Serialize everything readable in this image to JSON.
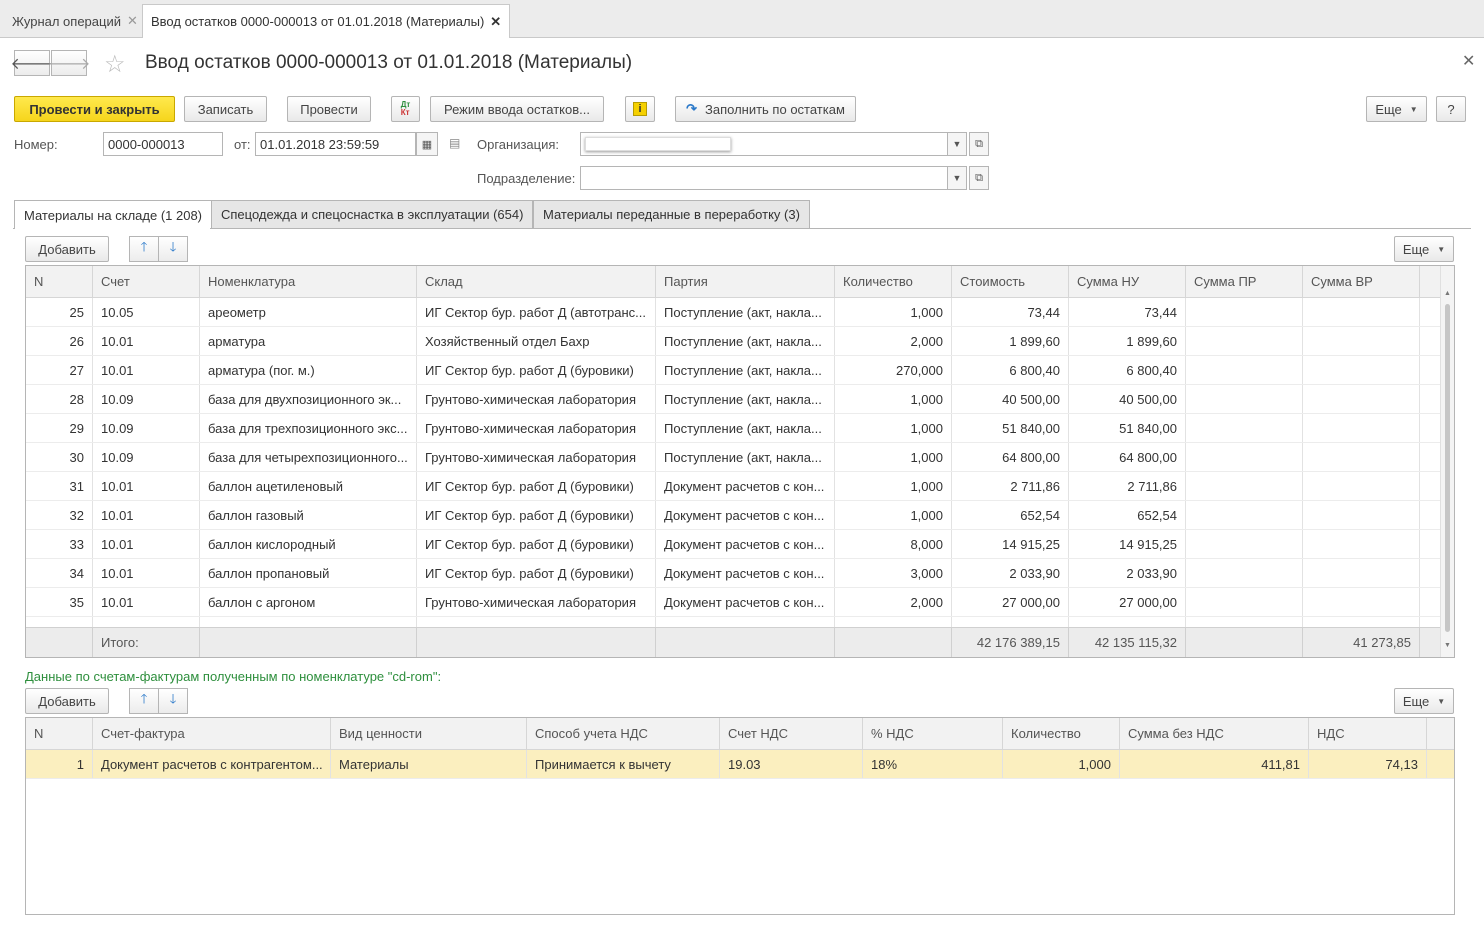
{
  "tabs": [
    {
      "label": "Журнал операций"
    },
    {
      "label": "Ввод остатков 0000-000013 от 01.01.2018 (Материалы)"
    }
  ],
  "title": "Ввод остатков 0000-000013 от 01.01.2018 (Материалы)",
  "toolbar": {
    "post_close": "Провести и закрыть",
    "save": "Записать",
    "post": "Провести",
    "dtkt": "ДтКт",
    "mode": "Режим ввода остатков...",
    "info": "i",
    "fill": "Заполнить по остаткам",
    "more": "Еще",
    "help": "?"
  },
  "form": {
    "number_label": "Номер:",
    "number_value": "0000-000013",
    "date_label": "от:",
    "date_value": "01.01.2018 23:59:59",
    "org_label": "Организация:",
    "org_value": "",
    "dept_label": "Подразделение:",
    "dept_value": ""
  },
  "page_tabs": [
    {
      "label": "Материалы на складе (1 208)"
    },
    {
      "label": "Спецодежда и спецоснастка в эксплуатации (654)"
    },
    {
      "label": "Материалы переданные в переработку (3)"
    }
  ],
  "table1": {
    "add": "Добавить",
    "more": "Еще",
    "headers": [
      "N",
      "Счет",
      "Номенклатура",
      "Склад",
      "Партия",
      "Количество",
      "Стоимость",
      "Сумма НУ",
      "Сумма ПР",
      "Сумма ВР"
    ],
    "rows": [
      [
        "25",
        "10.05",
        "ареометр",
        "ИГ Сектор бур. работ Д (автотранс...",
        "Поступление (акт, накла...",
        "1,000",
        "73,44",
        "73,44",
        "",
        ""
      ],
      [
        "26",
        "10.01",
        "арматура",
        "Хозяйственный отдел  Бахр",
        "Поступление (акт, накла...",
        "2,000",
        "1 899,60",
        "1 899,60",
        "",
        ""
      ],
      [
        "27",
        "10.01",
        "арматура (пог. м.)",
        "ИГ Сектор бур. работ Д (буровики)",
        "Поступление (акт, накла...",
        "270,000",
        "6 800,40",
        "6 800,40",
        "",
        ""
      ],
      [
        "28",
        "10.09",
        "база для двухпозиционного эк...",
        "Грунтово-химическая лаборатория",
        "Поступление (акт, накла...",
        "1,000",
        "40 500,00",
        "40 500,00",
        "",
        ""
      ],
      [
        "29",
        "10.09",
        "база для трехпозиционного экс...",
        "Грунтово-химическая лаборатория",
        "Поступление (акт, накла...",
        "1,000",
        "51 840,00",
        "51 840,00",
        "",
        ""
      ],
      [
        "30",
        "10.09",
        "база для четырехпозиционного...",
        "Грунтово-химическая лаборатория",
        "Поступление (акт, накла...",
        "1,000",
        "64 800,00",
        "64 800,00",
        "",
        ""
      ],
      [
        "31",
        "10.01",
        "баллон ацетиленовый",
        "ИГ Сектор бур. работ Д (буровики)",
        "Документ расчетов с кон...",
        "1,000",
        "2 711,86",
        "2 711,86",
        "",
        ""
      ],
      [
        "32",
        "10.01",
        "баллон газовый",
        "ИГ Сектор бур. работ Д (буровики)",
        "Документ расчетов с кон...",
        "1,000",
        "652,54",
        "652,54",
        "",
        ""
      ],
      [
        "33",
        "10.01",
        "баллон кислородный",
        "ИГ Сектор бур. работ Д (буровики)",
        "Документ расчетов с кон...",
        "8,000",
        "14 915,25",
        "14 915,25",
        "",
        ""
      ],
      [
        "34",
        "10.01",
        "баллон пропановый",
        "ИГ Сектор бур. работ Д (буровики)",
        "Документ расчетов с кон...",
        "3,000",
        "2 033,90",
        "2 033,90",
        "",
        ""
      ],
      [
        "35",
        "10.01",
        "баллон с аргоном",
        "Грунтово-химическая лаборатория",
        "Документ расчетов с кон...",
        "2,000",
        "27 000,00",
        "27 000,00",
        "",
        ""
      ]
    ],
    "footer": [
      "",
      "Итого:",
      "",
      "",
      "",
      "",
      "42 176 389,15",
      "42 135 115,32",
      "",
      "41 273,85"
    ]
  },
  "section_label": "Данные по счетам-фактурам полученным по номенклатуре \"cd-rom\":",
  "table2": {
    "add": "Добавить",
    "more": "Еще",
    "headers": [
      "N",
      "Счет-фактура",
      "Вид ценности",
      "Способ учета НДС",
      "Счет НДС",
      "% НДС",
      "Количество",
      "Сумма без НДС",
      "НДС"
    ],
    "rows": [
      [
        "1",
        "Документ расчетов с контрагентом...",
        "Материалы",
        "Принимается к вычету",
        "19.03",
        "18%",
        "1,000",
        "411,81",
        "74,13"
      ]
    ]
  }
}
